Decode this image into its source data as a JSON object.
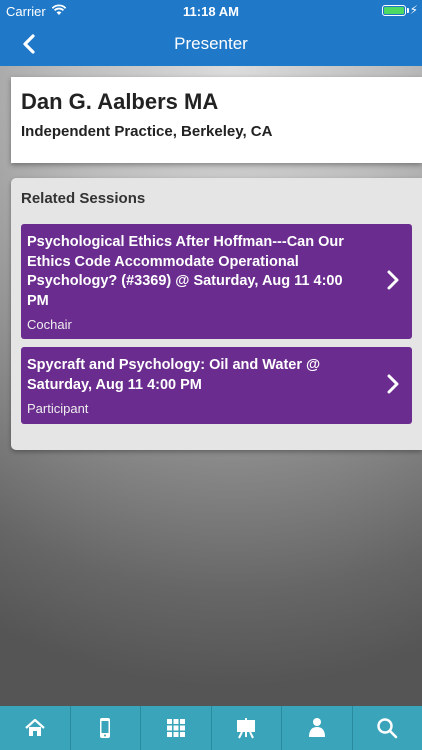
{
  "status_bar": {
    "carrier": "Carrier",
    "time": "11:18 AM",
    "wifi_icon": "wifi-icon",
    "battery_icon": "battery-charging-icon",
    "battery_color": "#4cd964"
  },
  "navbar": {
    "title": "Presenter",
    "back_icon": "chevron-left-icon",
    "color": "#1f78c8"
  },
  "presenter": {
    "name": "Dan G. Aalbers MA",
    "affiliation": "Independent Practice, Berkeley, CA"
  },
  "related_sessions": {
    "heading": "Related Sessions",
    "accent_color": "#6b2c8f",
    "items": [
      {
        "title": "Psychological Ethics After Hoffman---Can Our Ethics Code Accommodate Operational Psychology? (#3369) @ Saturday, Aug 11 4:00 PM",
        "role": "Cochair"
      },
      {
        "title": "Spycraft and Psychology: Oil and Water @ Saturday, Aug 11 4:00 PM",
        "role": "Participant"
      }
    ]
  },
  "tab_bar": {
    "color": "#3aa5ba",
    "tabs": [
      {
        "icon": "home-icon"
      },
      {
        "icon": "mobile-device-icon"
      },
      {
        "icon": "grid-icon"
      },
      {
        "icon": "presentation-board-icon"
      },
      {
        "icon": "person-icon"
      },
      {
        "icon": "search-icon"
      }
    ]
  }
}
